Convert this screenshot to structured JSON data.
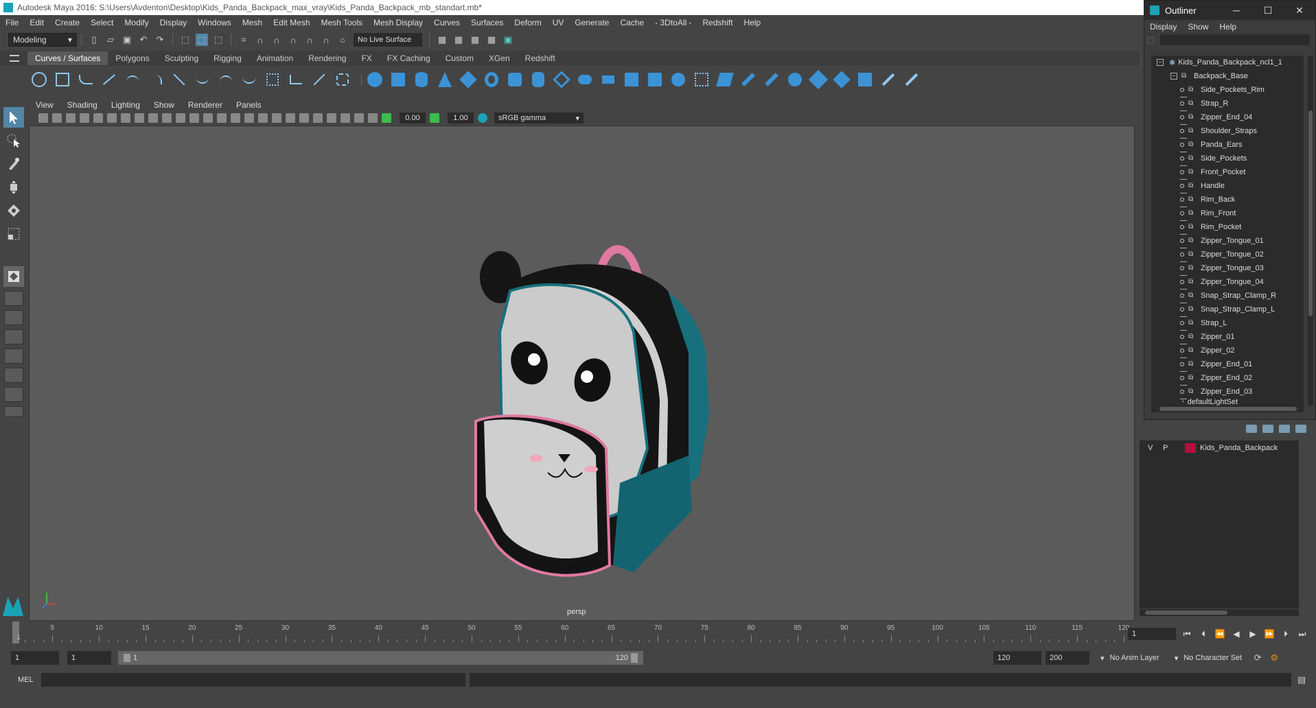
{
  "titlebar": {
    "title": "Autodesk Maya 2016: S:\\Users\\Avdenton\\Desktop\\Kids_Panda_Backpack_max_vray\\Kids_Panda_Backpack_mb_standart.mb*"
  },
  "menubar": [
    "File",
    "Edit",
    "Create",
    "Select",
    "Modify",
    "Display",
    "Windows",
    "Mesh",
    "Edit Mesh",
    "Mesh Tools",
    "Mesh Display",
    "Curves",
    "Surfaces",
    "Deform",
    "UV",
    "Generate",
    "Cache",
    "- 3DtoAll -",
    "Redshift",
    "Help"
  ],
  "statusline": {
    "mode": "Modeling",
    "live_surface": "No Live Surface"
  },
  "shelf": {
    "tabs": [
      "Curves / Surfaces",
      "Polygons",
      "Sculpting",
      "Rigging",
      "Animation",
      "Rendering",
      "FX",
      "FX Caching",
      "Custom",
      "XGen",
      "Redshift"
    ],
    "active_tab": "Curves / Surfaces"
  },
  "viewport": {
    "menu": [
      "View",
      "Shading",
      "Lighting",
      "Show",
      "Renderer",
      "Panels"
    ],
    "exposure": "0.00",
    "gamma": "1.00",
    "colorspace": "sRGB gamma",
    "camera_label": "persp"
  },
  "outliner": {
    "title": "Outliner",
    "menu": [
      "Display",
      "Show",
      "Help"
    ],
    "root": "Kids_Panda_Backpack_ncl1_1",
    "group": "Backpack_Base",
    "items": [
      "Side_Pockets_Rim",
      "Strap_R",
      "Zipper_End_04",
      "Shoulder_Straps",
      "Panda_Ears",
      "Side_Pockets",
      "Front_Pocket",
      "Handle",
      "Rim_Back",
      "Rim_Front",
      "Rim_Pocket",
      "Zipper_Tongue_01",
      "Zipper_Tongue_02",
      "Zipper_Tongue_03",
      "Zipper_Tongue_04",
      "Snap_Strap_Clamp_R",
      "Snap_Strap_Clamp_L",
      "Strap_L",
      "Zipper_01",
      "Zipper_02",
      "Zipper_End_01",
      "Zipper_End_02",
      "Zipper_End_03"
    ],
    "trailing": "defaultLightSet"
  },
  "layers": {
    "v": "V",
    "p": "P",
    "name": "Kids_Panda_Backpack",
    "color": "#b3123a"
  },
  "timeline": {
    "ticks": [
      "5",
      "10",
      "15",
      "20",
      "25",
      "30",
      "35",
      "40",
      "45",
      "50",
      "55",
      "60",
      "65",
      "70",
      "75",
      "80",
      "85",
      "90",
      "95",
      "100",
      "105",
      "110",
      "115",
      "120"
    ],
    "current": "1",
    "frame_field": "1"
  },
  "range": {
    "start": "1",
    "start2": "1",
    "inner_start": "1",
    "inner_end": "120",
    "end": "120",
    "end2": "200",
    "anim_layer": "No Anim Layer",
    "char_set": "No Character Set"
  },
  "cmdline": {
    "label": "MEL"
  }
}
